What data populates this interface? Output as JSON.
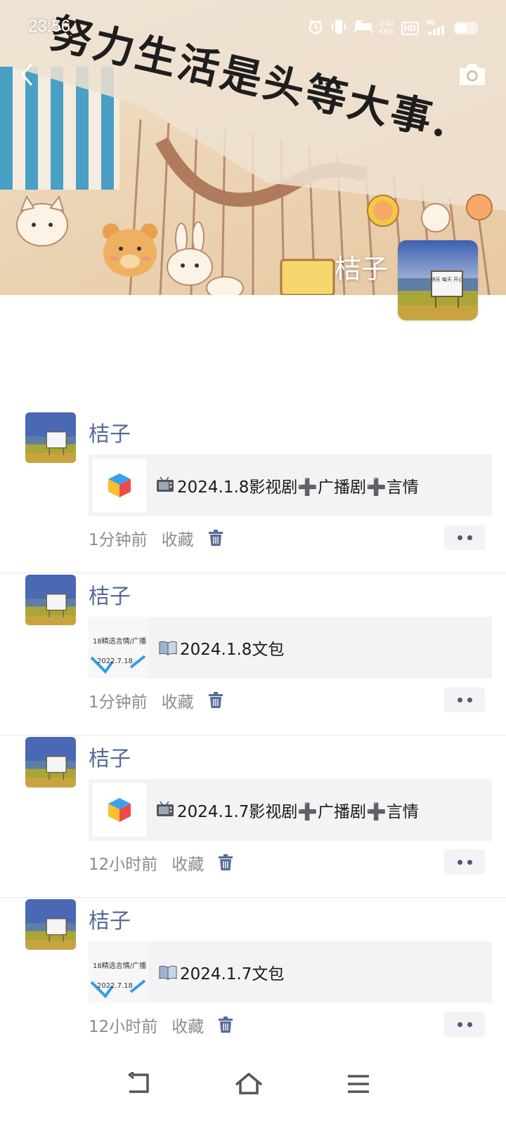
{
  "status_bar": {
    "time": "23:56",
    "net_speed_value": "0.00",
    "net_speed_unit": "KB/s",
    "hd_badge": "HD",
    "network": "5G",
    "icons": [
      "alarm-icon",
      "vibrate-icon",
      "sleep-mode-icon",
      "signal-icon",
      "battery-icon"
    ]
  },
  "cover": {
    "slogan": "努力生活是头等大事.",
    "back_icon": "chevron-left-icon",
    "camera_icon": "camera-icon"
  },
  "profile": {
    "name": "桔子",
    "sign_text": "快乐 每天 开心"
  },
  "posts": [
    {
      "author": "桔子",
      "thumb_type": "cube",
      "title_emoji": "tv-icon",
      "title": "2024.1.8影视剧➕广播剧➕言情",
      "time": "1分钟前",
      "favorite": "收藏"
    },
    {
      "author": "桔子",
      "thumb_type": "doc",
      "thumb_text_1": "18精选言情/广播",
      "thumb_text_2": "2022.7.18",
      "title_emoji": "book-icon",
      "title": "2024.1.8文包",
      "time": "1分钟前",
      "favorite": "收藏"
    },
    {
      "author": "桔子",
      "thumb_type": "cube",
      "title_emoji": "tv-icon",
      "title": "2024.1.7影视剧➕广播剧➕言情",
      "time": "12小时前",
      "favorite": "收藏"
    },
    {
      "author": "桔子",
      "thumb_type": "doc",
      "thumb_text_1": "18精选言情/广播",
      "thumb_text_2": "2022.7.18",
      "title_emoji": "book-icon",
      "title": "2024.1.7文包",
      "time": "12小时前",
      "favorite": "收藏"
    }
  ],
  "nav_bar": {
    "icons": [
      "back-nav-icon",
      "home-nav-icon",
      "menu-nav-icon"
    ]
  },
  "colors": {
    "author_link": "#576b95",
    "meta_text": "#8c8c8c",
    "card_bg": "#f3f3f5",
    "delete_icon": "#576b95"
  }
}
